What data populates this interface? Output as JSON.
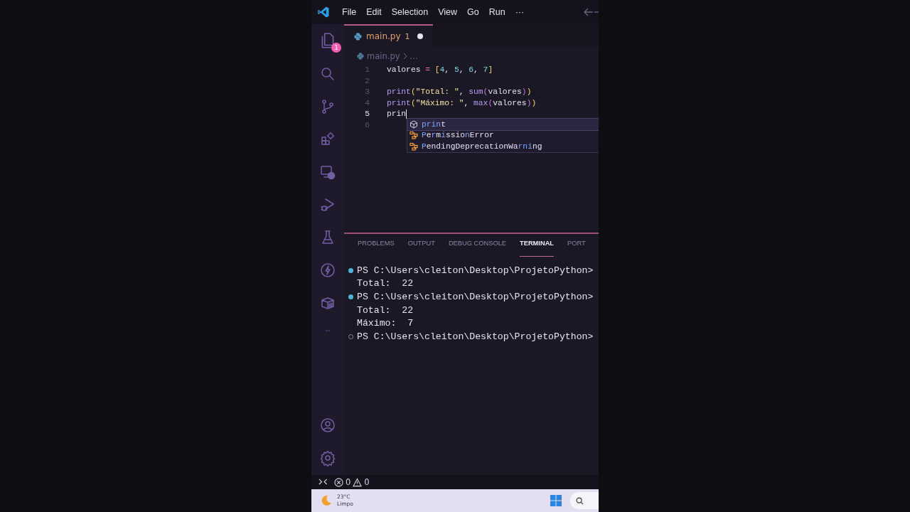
{
  "title_bar": {
    "menu": [
      "File",
      "Edit",
      "Selection",
      "View",
      "Go",
      "Run",
      "···"
    ]
  },
  "activity_bar": {
    "explorer_badge": "1"
  },
  "editor": {
    "tab": {
      "name": "main.py",
      "problems": "1",
      "modified": true
    },
    "breadcrumb": [
      "main.py",
      "…"
    ],
    "lines": [
      {
        "number": "1",
        "current": false,
        "tokens": [
          {
            "text": "valores ",
            "kind": "var"
          },
          {
            "text": "= ",
            "kind": "op"
          },
          {
            "text": "[",
            "kind": "bracket1"
          },
          {
            "text": "4",
            "kind": "number"
          },
          {
            "text": ", ",
            "kind": "plain"
          },
          {
            "text": "5",
            "kind": "number"
          },
          {
            "text": ", ",
            "kind": "plain"
          },
          {
            "text": "6",
            "kind": "number"
          },
          {
            "text": ", ",
            "kind": "plain"
          },
          {
            "text": "7",
            "kind": "number"
          },
          {
            "text": "]",
            "kind": "bracket1"
          }
        ]
      },
      {
        "number": "2",
        "current": false
      },
      {
        "number": "3",
        "current": false,
        "tokens": [
          {
            "text": "print",
            "kind": "func"
          },
          {
            "text": "(",
            "kind": "bracket1"
          },
          {
            "text": "\"Total: \"",
            "kind": "string"
          },
          {
            "text": ", ",
            "kind": "plain"
          },
          {
            "text": "sum",
            "kind": "func"
          },
          {
            "text": "(",
            "kind": "bracket2"
          },
          {
            "text": "valores",
            "kind": "var"
          },
          {
            "text": ")",
            "kind": "bracket2"
          },
          {
            "text": ")",
            "kind": "bracket1"
          }
        ]
      },
      {
        "number": "4",
        "current": false,
        "tokens": [
          {
            "text": "print",
            "kind": "func"
          },
          {
            "text": "(",
            "kind": "bracket1"
          },
          {
            "text": "\"Máximo: \"",
            "kind": "string"
          },
          {
            "text": ", ",
            "kind": "plain"
          },
          {
            "text": "max",
            "kind": "func"
          },
          {
            "text": "(",
            "kind": "bracket2"
          },
          {
            "text": "valores",
            "kind": "var"
          },
          {
            "text": ")",
            "kind": "bracket2"
          },
          {
            "text": ")",
            "kind": "bracket1"
          }
        ]
      },
      {
        "number": "5",
        "current": true,
        "tokens": [
          {
            "text": "prin",
            "kind": "plain"
          }
        ]
      },
      {
        "number": "6",
        "current": false
      }
    ],
    "suggestions": [
      {
        "kind": "function",
        "selected": true,
        "parts": [
          {
            "text": "prin",
            "match": true
          },
          {
            "text": "t",
            "match": false
          }
        ]
      },
      {
        "kind": "class",
        "selected": false,
        "parts": [
          {
            "text": "P",
            "match": true
          },
          {
            "text": "e",
            "match": false
          },
          {
            "text": "r",
            "match": true
          },
          {
            "text": "m",
            "match": false
          },
          {
            "text": "i",
            "match": true
          },
          {
            "text": "ssio",
            "match": false
          },
          {
            "text": "n",
            "match": true
          },
          {
            "text": "Error",
            "match": false
          }
        ]
      },
      {
        "kind": "class",
        "selected": false,
        "parts": [
          {
            "text": "P",
            "match": true
          },
          {
            "text": "endingDeprecationWa",
            "match": false
          },
          {
            "text": "rni",
            "match": true
          },
          {
            "text": "ng",
            "match": false
          }
        ]
      }
    ]
  },
  "panel": {
    "tabs": [
      {
        "label": "PROBLEMS",
        "selected": false
      },
      {
        "label": "OUTPUT",
        "selected": false
      },
      {
        "label": "DEBUG CONSOLE",
        "selected": false
      },
      {
        "label": "TERMINAL",
        "selected": true
      },
      {
        "label": "PORT",
        "selected": false
      }
    ],
    "terminal": [
      {
        "kind": "prompt-done",
        "text": "PS C:\\Users\\cleiton\\Desktop\\ProjetoPython>"
      },
      {
        "kind": "output",
        "text": "Total:  22"
      },
      {
        "kind": "prompt-done",
        "text": "PS C:\\Users\\cleiton\\Desktop\\ProjetoPython>"
      },
      {
        "kind": "output",
        "text": "Total:  22"
      },
      {
        "kind": "output",
        "text": "Máximo:  7"
      },
      {
        "kind": "prompt-idle",
        "text": "PS C:\\Users\\cleiton\\Desktop\\ProjetoPython>"
      }
    ]
  },
  "status_bar": {
    "errors": "0",
    "warnings": "0"
  },
  "taskbar": {
    "temperature": "23°C",
    "condition": "Limpo"
  }
}
